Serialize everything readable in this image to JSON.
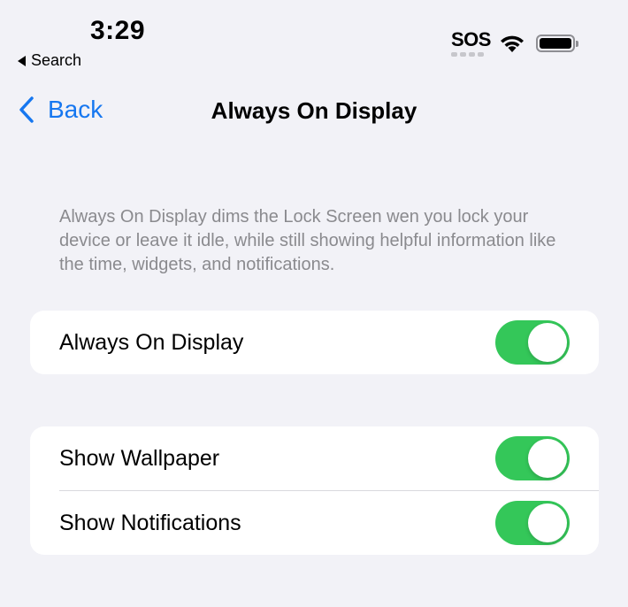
{
  "status_bar": {
    "time": "3:29",
    "back_app": "Search",
    "carrier": "SOS"
  },
  "nav": {
    "back_label": "Back",
    "title": "Always On Display"
  },
  "description": "Always On Display dims the Lock Screen wen you lock your device or leave it idle, while still showing helpful information like the time, widgets, and notifications.",
  "groups": [
    {
      "rows": [
        {
          "label": "Always On Display",
          "on": true
        }
      ]
    },
    {
      "rows": [
        {
          "label": "Show Wallpaper",
          "on": true
        },
        {
          "label": "Show Notifications",
          "on": true
        }
      ]
    }
  ],
  "colors": {
    "accent": "#1677f0",
    "toggle_on": "#34c759",
    "background": "#f2f2f7"
  }
}
